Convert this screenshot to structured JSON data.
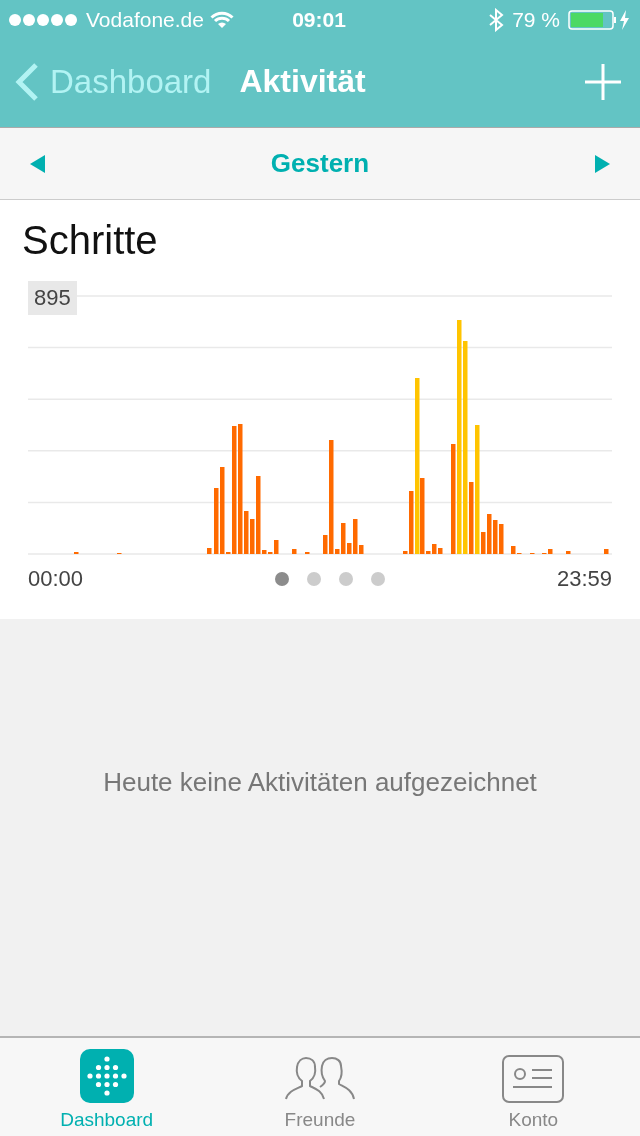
{
  "status_bar": {
    "carrier": "Vodafone.de",
    "time": "09:01",
    "battery": "79 %"
  },
  "nav_bar": {
    "back": "Dashboard",
    "title": "Aktivität"
  },
  "date_bar": {
    "label": "Gestern"
  },
  "steps_card": {
    "title": "Schritte",
    "max_label": "895",
    "start_time": "00:00",
    "end_time": "23:59",
    "pages": [
      {
        "selected": true
      },
      {
        "selected": false
      },
      {
        "selected": false
      },
      {
        "selected": false
      }
    ]
  },
  "empty_message": "Heute keine Aktivitäten aufgezeichnet",
  "tabs": [
    {
      "label": "Dashboard",
      "kind": "dashboard",
      "selected": true
    },
    {
      "label": "Freunde",
      "kind": "friends",
      "selected": false
    },
    {
      "label": "Konto",
      "kind": "account",
      "selected": false
    }
  ]
}
